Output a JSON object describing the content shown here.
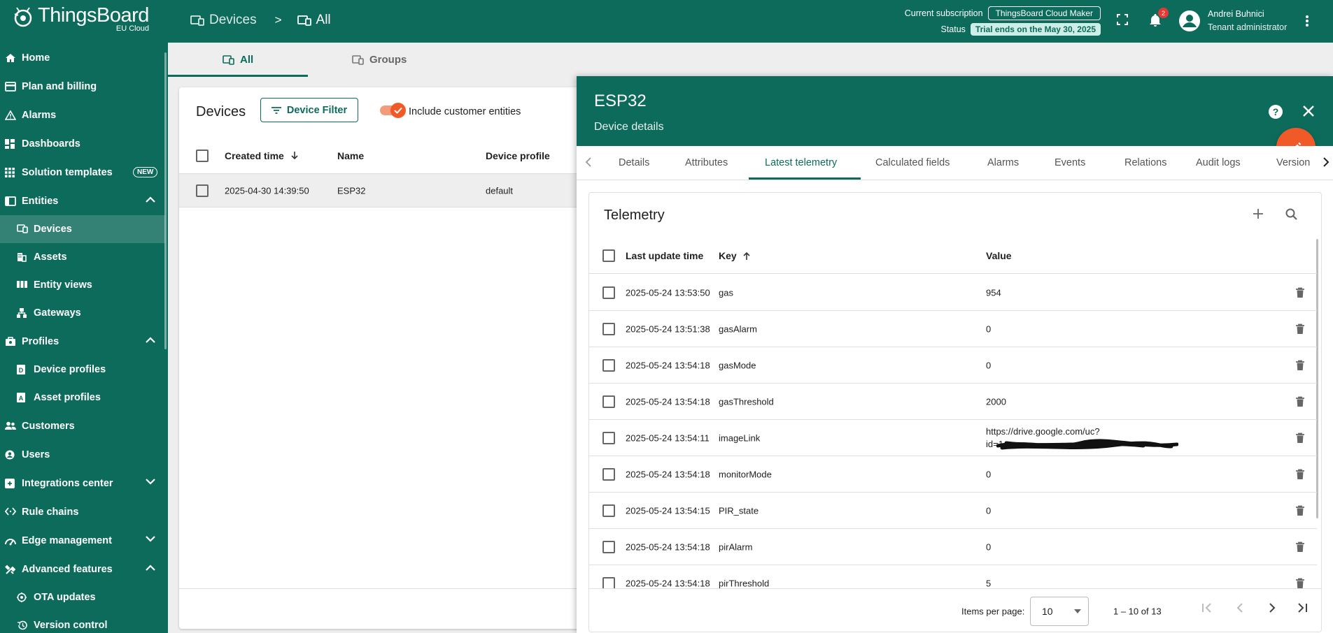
{
  "topbar": {
    "logo_name": "ThingsBoard",
    "logo_sub": "EU Cloud",
    "breadcrumb": [
      {
        "label": "Devices",
        "icon": "devices-icon"
      },
      {
        "label": "All",
        "icon": "devices-icon"
      }
    ],
    "breadcrumb_sep": ">",
    "subscription_label": "Current subscription",
    "subscription_value": "ThingsBoard Cloud Maker",
    "status_label": "Status",
    "status_value": "Trial ends on the May 30, 2025",
    "notification_count": "2",
    "user_name": "Andrei Buhnici",
    "user_role": "Tenant administrator"
  },
  "sidebar": {
    "items": [
      {
        "label": "Home",
        "icon": "home-icon"
      },
      {
        "label": "Plan and billing",
        "icon": "billing-icon"
      },
      {
        "label": "Alarms",
        "icon": "alarm-icon"
      },
      {
        "label": "Dashboards",
        "icon": "dashboard-icon"
      },
      {
        "label": "Solution templates",
        "icon": "apps-icon",
        "badge": "NEW"
      },
      {
        "label": "Entities",
        "icon": "entities-icon",
        "expanded": true
      },
      {
        "label": "Devices",
        "icon": "devices-icon",
        "active": true
      },
      {
        "label": "Assets",
        "icon": "assets-icon"
      },
      {
        "label": "Entity views",
        "icon": "entity-views-icon"
      },
      {
        "label": "Gateways",
        "icon": "gateway-icon"
      },
      {
        "label": "Profiles",
        "icon": "profiles-icon",
        "expanded": true
      },
      {
        "label": "Device profiles",
        "icon": "device-profile-icon"
      },
      {
        "label": "Asset profiles",
        "icon": "asset-profile-icon"
      },
      {
        "label": "Customers",
        "icon": "customers-icon"
      },
      {
        "label": "Users",
        "icon": "users-icon"
      },
      {
        "label": "Integrations center",
        "icon": "integrations-icon",
        "expanded": false
      },
      {
        "label": "Rule chains",
        "icon": "rule-chains-icon"
      },
      {
        "label": "Edge management",
        "icon": "edge-icon",
        "expanded": false
      },
      {
        "label": "Advanced features",
        "icon": "tools-icon",
        "expanded": true
      },
      {
        "label": "OTA updates",
        "icon": "ota-icon"
      },
      {
        "label": "Version control",
        "icon": "history-icon"
      }
    ]
  },
  "main_tabs": [
    {
      "label": "All",
      "active": true
    },
    {
      "label": "Groups",
      "active": false
    }
  ],
  "devices": {
    "title": "Devices",
    "filter_label": "Device Filter",
    "include_label": "Include customer entities",
    "include_checked": true,
    "columns": [
      "Created time",
      "Name",
      "Device profile"
    ],
    "rows": [
      {
        "created": "2025-04-30 14:39:50",
        "name": "ESP32",
        "profile": "default"
      }
    ]
  },
  "details": {
    "title": "ESP32",
    "subtitle": "Device details",
    "tabs": [
      "Details",
      "Attributes",
      "Latest telemetry",
      "Calculated fields",
      "Alarms",
      "Events",
      "Relations",
      "Audit logs",
      "Version"
    ],
    "active_tab": "Latest telemetry",
    "telemetry": {
      "title": "Telemetry",
      "columns": [
        "Last update time",
        "Key",
        "Value"
      ],
      "rows": [
        {
          "time": "2025-05-24 13:53:50",
          "key": "gas",
          "value": "954"
        },
        {
          "time": "2025-05-24 13:51:38",
          "key": "gasAlarm",
          "value": "0"
        },
        {
          "time": "2025-05-24 13:54:18",
          "key": "gasMode",
          "value": "0"
        },
        {
          "time": "2025-05-24 13:54:18",
          "key": "gasThreshold",
          "value": "2000"
        },
        {
          "time": "2025-05-24 13:54:11",
          "key": "imageLink",
          "value": "https://drive.google.com/uc?",
          "value2": "id=1"
        },
        {
          "time": "2025-05-24 13:54:18",
          "key": "monitorMode",
          "value": "0"
        },
        {
          "time": "2025-05-24 13:54:15",
          "key": "PIR_state",
          "value": "0"
        },
        {
          "time": "2025-05-24 13:54:18",
          "key": "pirAlarm",
          "value": "0"
        },
        {
          "time": "2025-05-24 13:54:18",
          "key": "pirThreshold",
          "value": "5"
        }
      ],
      "items_per_page_label": "Items per page:",
      "items_per_page": "10",
      "range": "1 – 10 of 13"
    }
  },
  "colors": {
    "brand": "#0c6b5b",
    "accent": "#f05a28"
  }
}
